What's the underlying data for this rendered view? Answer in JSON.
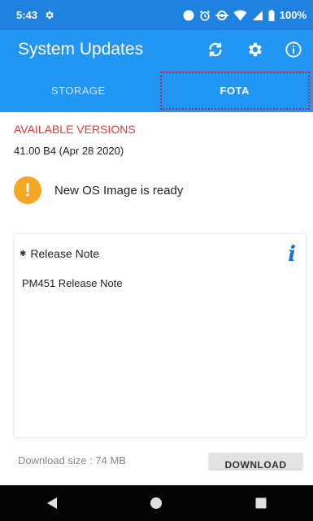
{
  "status_bar": {
    "time": "5:43",
    "battery": "100%",
    "icons": [
      "gear-icon",
      "circle-icon",
      "alarm-icon",
      "data-saver-icon",
      "wifi-icon",
      "signal-icon",
      "battery-icon"
    ]
  },
  "app_bar": {
    "title": "System Updates",
    "actions": [
      "sync-icon",
      "settings-gear-icon",
      "info-icon"
    ]
  },
  "tabs": [
    {
      "label": "STORAGE",
      "active": false
    },
    {
      "label": "FOTA",
      "active": true
    }
  ],
  "content": {
    "versions_heading": "AVAILABLE VERSIONS",
    "version": "41.00 B4 (Apr 28 2020)",
    "status_message": "New OS Image is ready",
    "status_icon": "exclamation",
    "release_note": {
      "header": "Release Note",
      "text": "PM451 Release Note"
    },
    "download_size": "Download size : 74 MB",
    "download_button": "DOWNLOAD"
  },
  "colors": {
    "status_bar": "#1f82e0",
    "app_bar": "#2196f3",
    "heading_red": "#e53935",
    "warning_orange": "#f5a623",
    "info_blue": "#1976d2",
    "highlight_dotted": "#e0163a",
    "nav_bar": "#050505"
  },
  "nav_bar": [
    "back-icon",
    "home-icon",
    "recents-icon"
  ]
}
